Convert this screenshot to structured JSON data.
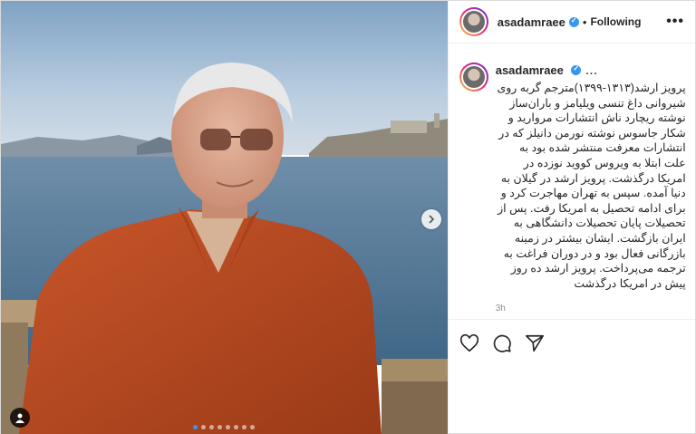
{
  "header": {
    "username": "asadamraee",
    "dot": "•",
    "follow_label": "Following",
    "more_label": "•••"
  },
  "caption": {
    "username": "asadamraee",
    "ellipsis": "...",
    "text": "پرویز ارشد(۱۳۱۳-۱۳۹۹)مترجم گربه روی شیروانی داغ تنسی ویلیامز و باران‌ساز نوشته ریچارد ناش انتشارات مروارید و شکار جاسوس نوشته نورمن دانیلز که در انتشارات معرفت منتشر شده بود به علت ابتلا به ویروس کووید نوزده در امریکا درگذشت. پرویز ارشد در گیلان به دنیا آمده. سپس به تهران مهاجرت کرد و برای ادامه تحصیل به امریکا رفت. پس از تحصیلات پایان تحصیلات دانشگاهی به ایران بازگشت. ایشان بیشتر در زمینه بازرگانی فعال بود و در دوران فراغت به ترجمه می‌پرداخت. پرویز ارشد ده روز پیش در امریکا درگذشت",
    "time": "3h"
  },
  "icons": [
    "heart-icon",
    "comment-icon",
    "share-icon",
    "chevron-right-icon",
    "tag-user-icon",
    "more-icon",
    "verified-icon"
  ],
  "colors": {
    "accent": "#3897f0",
    "shirt": "#b8461f",
    "sea": "#5c7f9c"
  },
  "carousel": {
    "count": 8,
    "active": 0
  }
}
